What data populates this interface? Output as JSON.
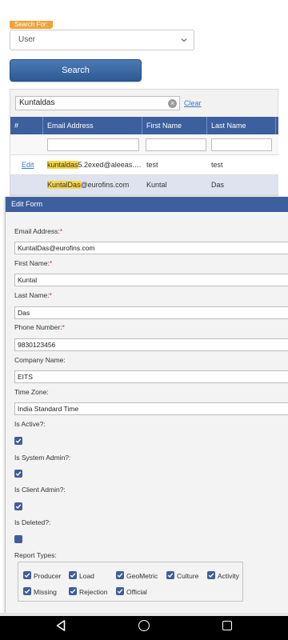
{
  "search": {
    "for_label": "Search For:",
    "select_value": "User",
    "button_label": "Search"
  },
  "grid": {
    "filter_value": "Kuntaldas",
    "clear_label": "Clear",
    "columns": [
      "#",
      "Email Address",
      "First Name",
      "Last Name"
    ],
    "rows": [
      {
        "action": "Edit",
        "email_highlight": "kuntaldas",
        "email_rest": "5.2exed@aleeas.c...",
        "first_name": "test",
        "last_name": "test"
      },
      {
        "action": "",
        "email_highlight": "KuntalDas",
        "email_rest": "@eurofins.com",
        "first_name": "Kuntal",
        "last_name": "Das"
      }
    ]
  },
  "form": {
    "title": "Edit Form",
    "email_label": "Email Address:",
    "email_value": "KuntalDas@eurofins.com",
    "first_name_label": "First Name:",
    "first_name_value": "Kuntal",
    "last_name_label": "Last Name:",
    "last_name_value": "Das",
    "phone_label": "Phone Number:",
    "phone_value": "9830123456",
    "company_label": "Company Name:",
    "company_value": "EITS",
    "timezone_label": "Time Zone:",
    "timezone_value": "India Standard Time",
    "is_active_label": "Is Active?:",
    "is_active": true,
    "is_system_admin_label": "Is System Admin?:",
    "is_system_admin": true,
    "is_client_admin_label": "Is Client Admin?:",
    "is_client_admin": true,
    "is_deleted_label": "Is Deleted?:",
    "is_deleted": false,
    "report_types_label": "Report Types:",
    "report_types": [
      {
        "label": "Producer",
        "checked": true
      },
      {
        "label": "Load",
        "checked": true
      },
      {
        "label": "GeoMetric",
        "checked": true
      },
      {
        "label": "Culture",
        "checked": true
      },
      {
        "label": "Activity",
        "checked": true
      },
      {
        "label": "Missing",
        "checked": true
      },
      {
        "label": "Rejection",
        "checked": true
      },
      {
        "label": "Official",
        "checked": true
      }
    ],
    "required_mark": "*"
  },
  "colors": {
    "header_blue": "#3d5f9e",
    "highlight": "#f7d748",
    "required": "#d9262c",
    "link": "#3a7bc8"
  }
}
